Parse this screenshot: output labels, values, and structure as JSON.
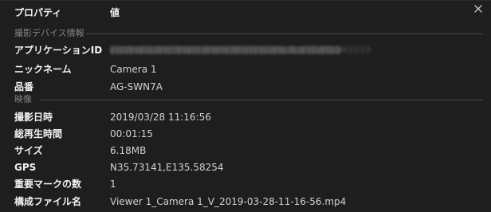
{
  "header": {
    "property_label": "プロパティ",
    "value_label": "値"
  },
  "sections": {
    "device": "撮影デバイス情報",
    "video": "映像"
  },
  "device": {
    "app_id_label": "アプリケーションID",
    "app_id_value": "01d9a83d4079b9fc0f46438383b196c4cd31d8b042115",
    "nickname_label": "ニックネーム",
    "nickname_value": "Camera 1",
    "model_label": "品番",
    "model_value": "AG-SWN7A"
  },
  "video": {
    "date_label": "撮影日時",
    "date_value": "2019/03/28 11:16:56",
    "duration_label": "総再生時間",
    "duration_value": "00:01:15",
    "size_label": "サイズ",
    "size_value": "6.18MB",
    "gps_label": "GPS",
    "gps_value": "N35.73141,E135.58254",
    "marks_label": "重要マークの数",
    "marks_value": "1",
    "files_label": "構成ファイル名",
    "files_value": "Viewer 1_Camera 1_V_2019-03-28-11-16-56.mp4"
  },
  "icons": {
    "close": "close-icon"
  },
  "colors": {
    "background": "#1e1e1e",
    "section_line": "#4a4a4a",
    "section_text": "#858585"
  }
}
